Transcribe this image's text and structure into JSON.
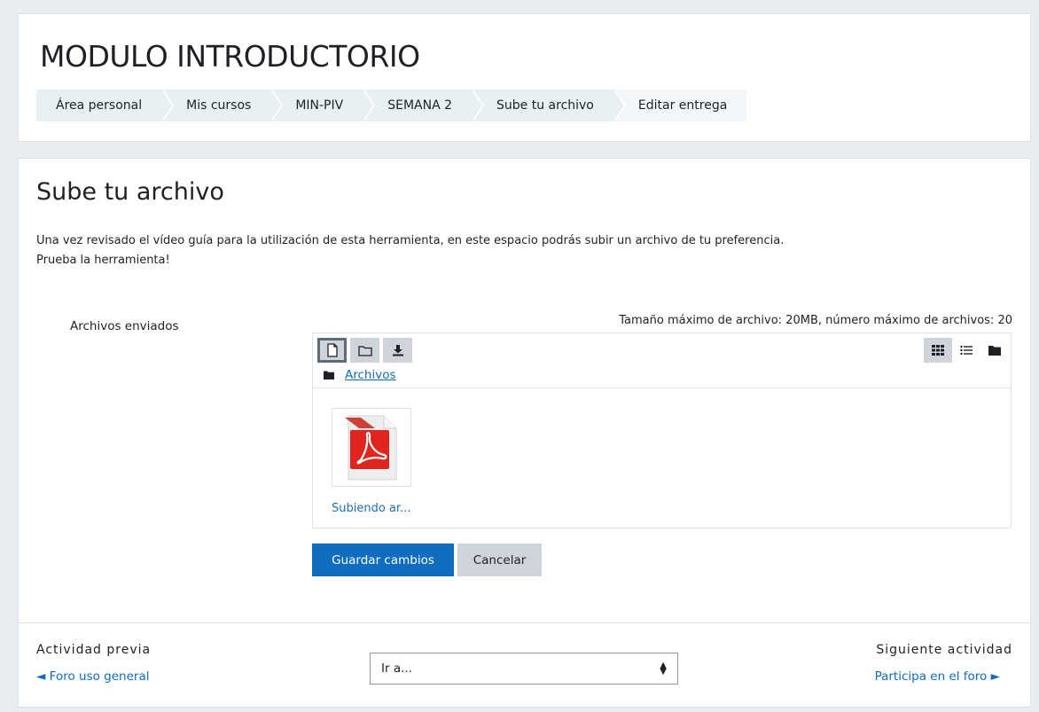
{
  "header": {
    "course_title": "MODULO INTRODUCTORIO",
    "breadcrumb": [
      {
        "label": "Área personal"
      },
      {
        "label": "Mis cursos"
      },
      {
        "label": "MIN-PIV"
      },
      {
        "label": "SEMANA 2"
      },
      {
        "label": "Sube tu archivo"
      },
      {
        "label": "Editar entrega"
      }
    ]
  },
  "main": {
    "page_title": "Sube tu archivo",
    "intro_line1": "Una vez revisado el vídeo guía para la utilización de esta herramienta, en este espacio podrás subir un archivo de tu preferencia.",
    "intro_line2": "Prueba la herramienta!",
    "field_label": "Archivos enviados",
    "max_size_text": "Tamaño máximo de archivo: 20MB, número máximo de archivos: 20"
  },
  "filemanager": {
    "toolbar_buttons": [
      {
        "name": "add-file",
        "icon": "file-icon"
      },
      {
        "name": "create-folder",
        "icon": "folder-icon"
      },
      {
        "name": "download",
        "icon": "download-icon"
      }
    ],
    "view_modes": [
      {
        "name": "icons",
        "icon": "grid-icon",
        "selected": true
      },
      {
        "name": "list",
        "icon": "list-icon",
        "selected": false
      },
      {
        "name": "tree",
        "icon": "folder-icon",
        "selected": false
      }
    ],
    "path_label": "Archivos",
    "files": [
      {
        "name": "Subiendo ar...",
        "type": "pdf"
      }
    ]
  },
  "form_buttons": {
    "save_label": "Guardar cambios",
    "cancel_label": "Cancelar"
  },
  "activity_nav": {
    "prev_label": "Actividad previa",
    "prev_link": "◄ Foro uso general",
    "jump_placeholder": "Ir a...",
    "next_label": "Siguiente actividad",
    "next_link": "Participa en el foro ►"
  },
  "colors": {
    "primary": "#0f6cbf",
    "background": "#e8edf1",
    "breadcrumb_bg": "#e9f0f4",
    "button_secondary": "#ced4da",
    "pdf_red": "#e0251e"
  }
}
